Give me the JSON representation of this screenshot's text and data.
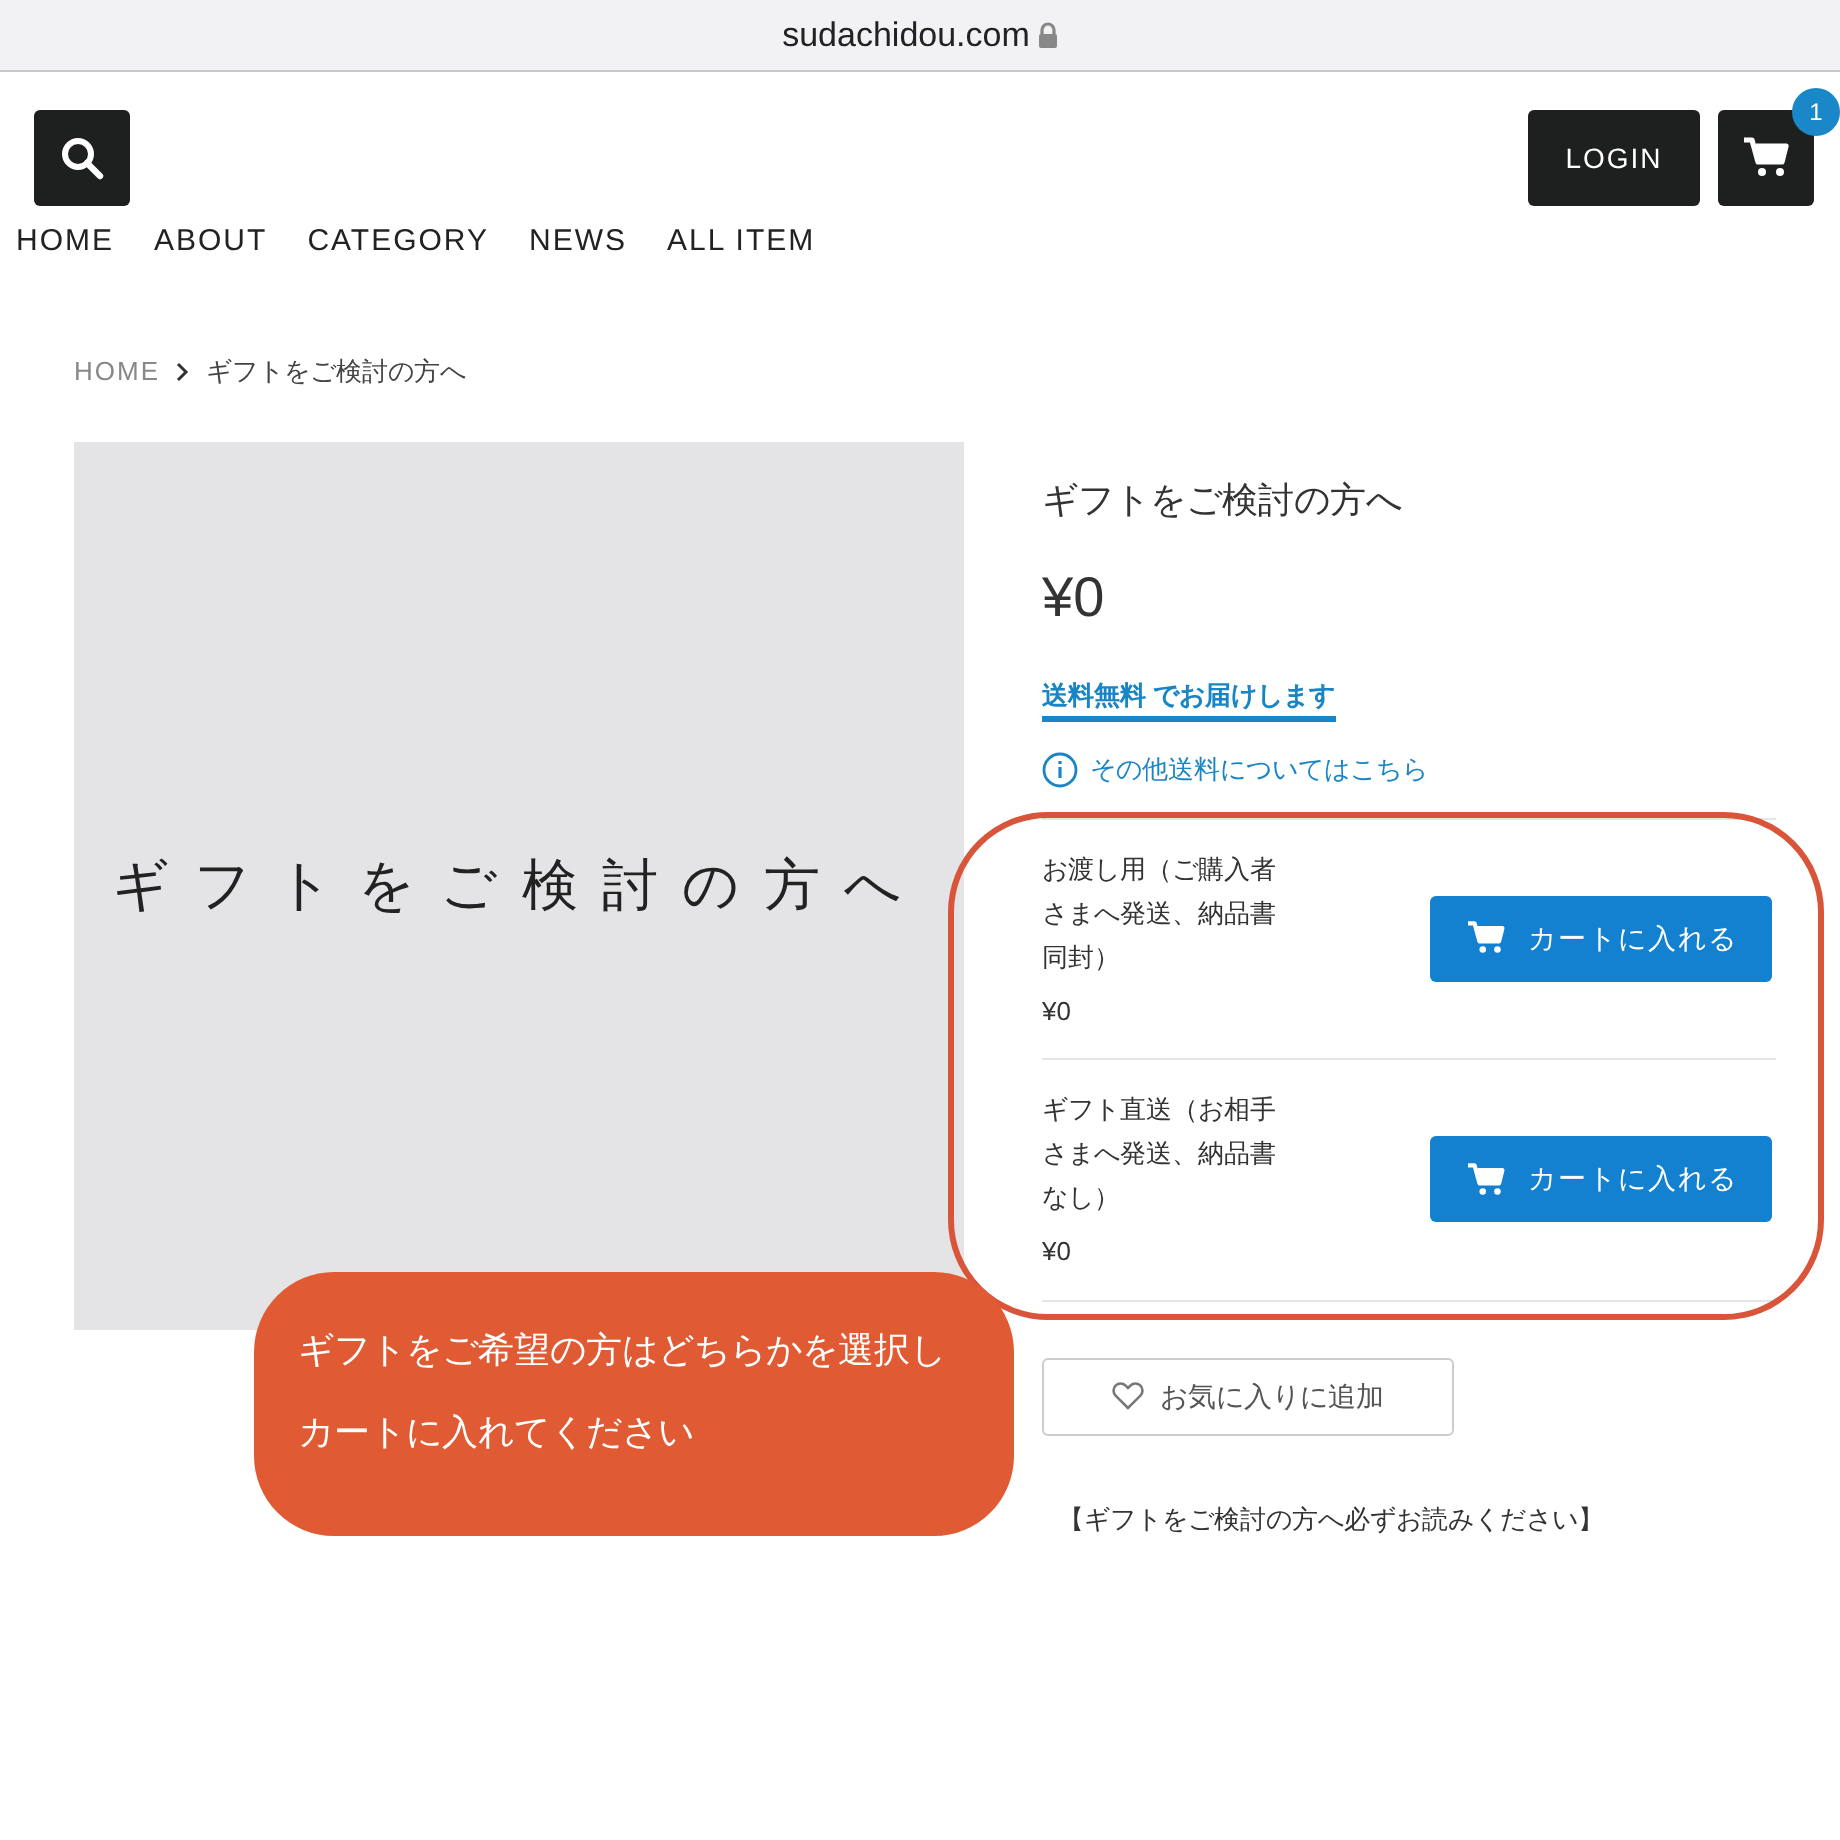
{
  "browser": {
    "url": "sudachidou.com"
  },
  "header": {
    "login": "LOGIN",
    "cart_count": "1",
    "nav": [
      {
        "label": "HOME"
      },
      {
        "label": "ABOUT"
      },
      {
        "label": "CATEGORY"
      },
      {
        "label": "NEWS"
      },
      {
        "label": "ALL ITEM"
      }
    ]
  },
  "breadcrumb": [
    "HOME",
    "ギフトをご検討の方へ"
  ],
  "product": {
    "image_text": "ギフトをご検討の方へ",
    "title": "ギフトをご検討の方へ",
    "price": "¥0",
    "free_shipping": "**送料無料** でお届けします",
    "shipping_link": "その他送料についてはこちら",
    "options": [
      {
        "name": "お渡し用（ご購入者さまへ発送、納品書同封）",
        "price": "¥0",
        "button": "カートに入れる"
      },
      {
        "name": "ギフト直送（お相手さまへ発送、納品書なし）",
        "price": "¥0",
        "button": "カートに入れる"
      }
    ],
    "favorite": "お気に入りに追加",
    "notice": "【ギフトをご検討の方へ必ずお読みください】"
  },
  "callout": {
    "lines": [
      "ギフトをご希望の方はどちらかを選択し",
      "カートに入れてください"
    ]
  }
}
